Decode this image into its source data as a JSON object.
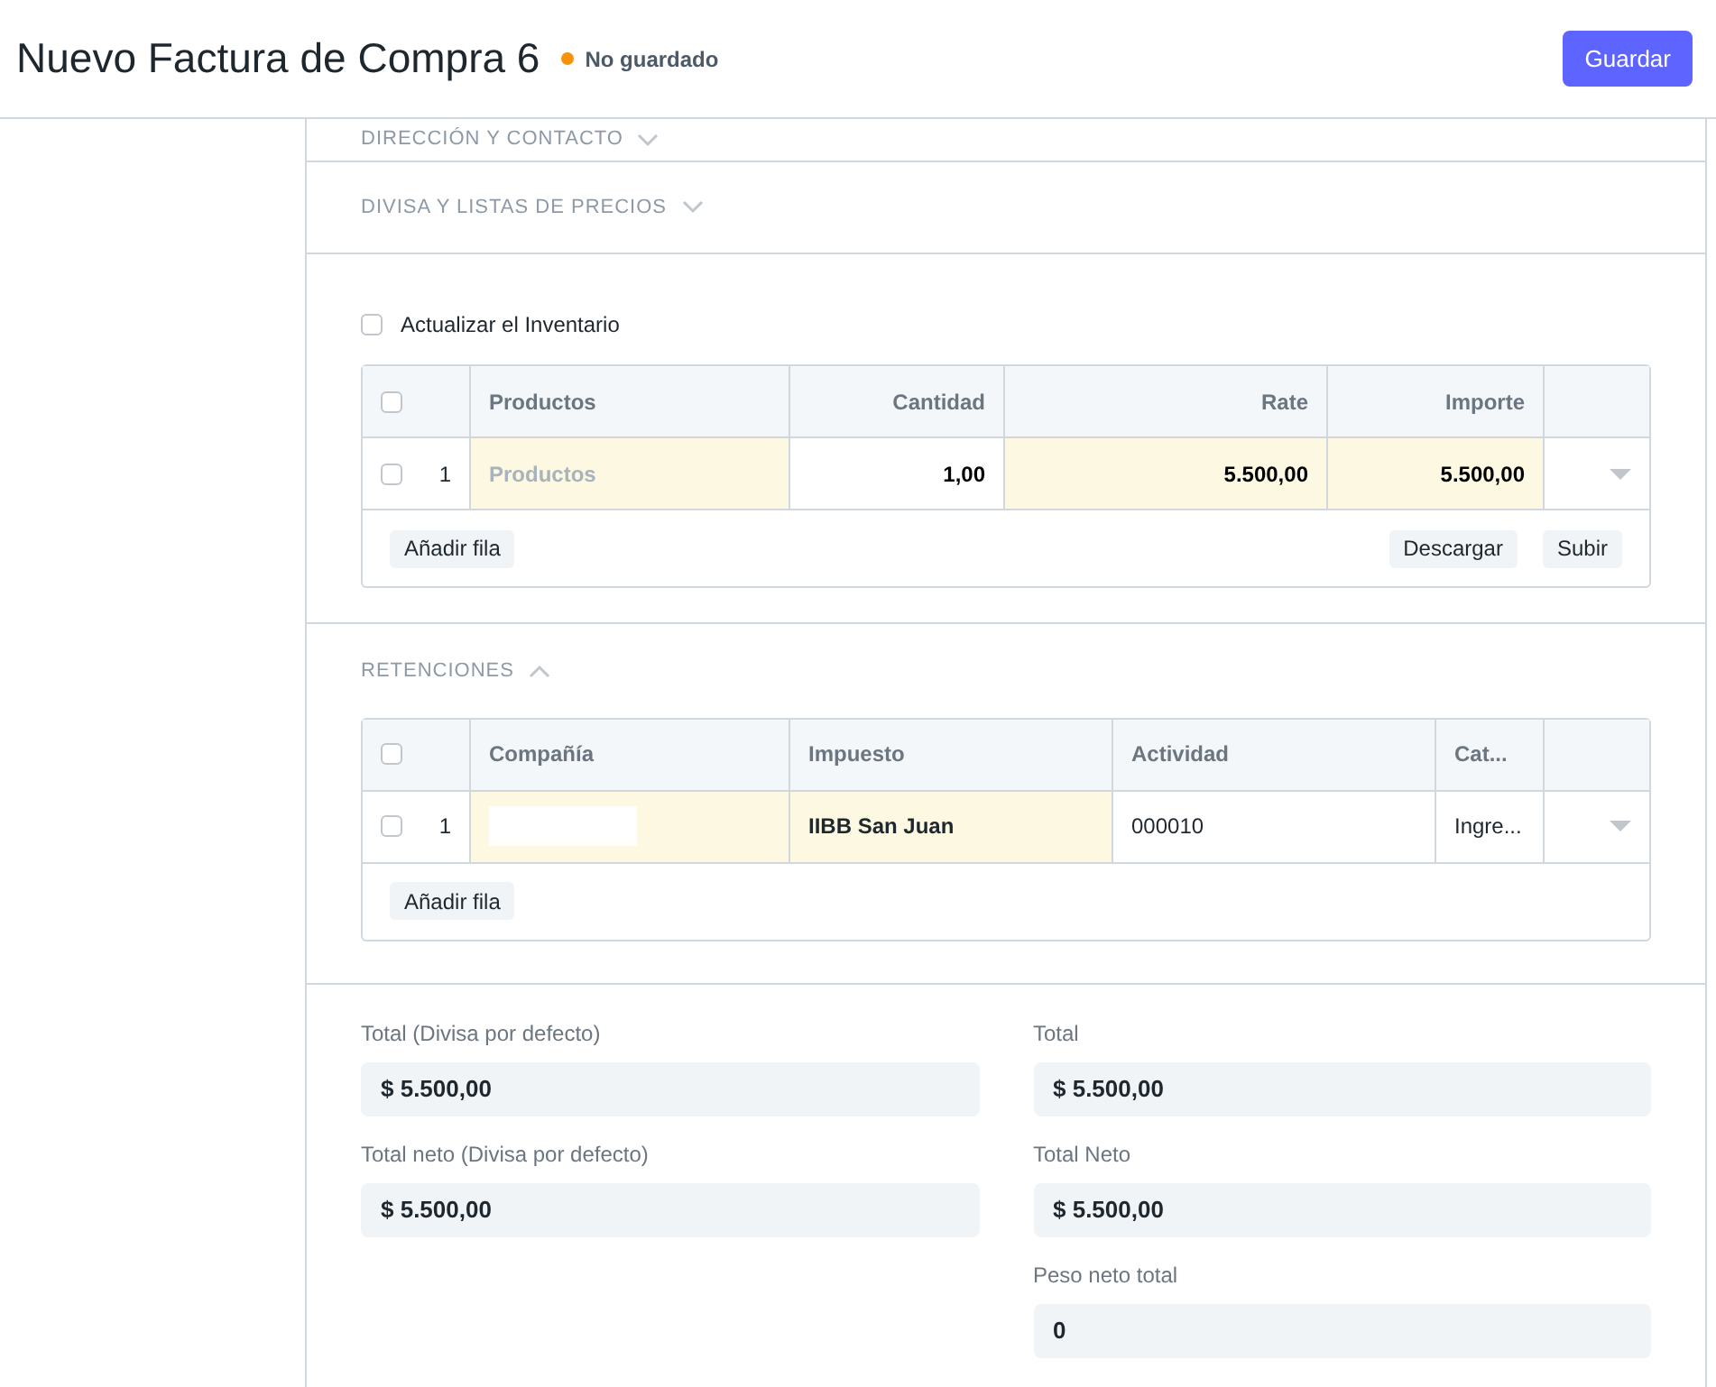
{
  "header": {
    "title": "Nuevo Factura de Compra 6",
    "status": {
      "label": "No guardado",
      "color": "#f5930b"
    },
    "save_button": "Guardar"
  },
  "sections": [
    {
      "label": "DIRECCIÓN Y CONTACTO",
      "expanded": false
    },
    {
      "label": "DIVISA Y LISTAS DE PRECIOS",
      "expanded": false
    }
  ],
  "update_stock": {
    "label": "Actualizar el Inventario",
    "checked": false
  },
  "items_table": {
    "all_selected": false,
    "columns": [
      "Productos",
      "Cantidad",
      "Rate",
      "Importe"
    ],
    "rows": [
      {
        "index": "1",
        "selected": false,
        "cells": [
          {
            "kind": "placeholder",
            "text": "Productos",
            "required": true
          },
          {
            "kind": "number",
            "text": "1,00",
            "required": false
          },
          {
            "kind": "number",
            "text": "5.500,00",
            "required": true
          },
          {
            "kind": "number",
            "text": "5.500,00",
            "required": true
          }
        ]
      }
    ],
    "left_buttons": [
      "Añadir fila"
    ],
    "right_buttons": [
      "Descargar",
      "Subir"
    ]
  },
  "retenciones": {
    "label": "RETENCIONES",
    "expanded": true,
    "table": {
      "all_selected": false,
      "columns": [
        "Compañía",
        "Impuesto",
        "Actividad",
        "Cat..."
      ],
      "rows": [
        {
          "index": "1",
          "selected": false,
          "cells": [
            {
              "kind": "blank",
              "required": true
            },
            {
              "kind": "link",
              "text": "IIBB San Juan",
              "required": true
            },
            {
              "kind": "text",
              "text": "000010",
              "required": false
            },
            {
              "kind": "text",
              "text": "Ingre...",
              "required": false
            }
          ]
        }
      ],
      "left_buttons": [
        "Añadir fila"
      ]
    }
  },
  "totals": {
    "left": [
      {
        "label": "Total (Divisa por defecto)",
        "value": "$ 5.500,00"
      },
      {
        "label": "Total neto (Divisa por defecto)",
        "value": "$ 5.500,00"
      }
    ],
    "right": [
      {
        "label": "Total",
        "value": "$ 5.500,00"
      },
      {
        "label": "Total Neto",
        "value": "$ 5.500,00"
      },
      {
        "label": "Peso neto total",
        "value": "0"
      }
    ]
  }
}
